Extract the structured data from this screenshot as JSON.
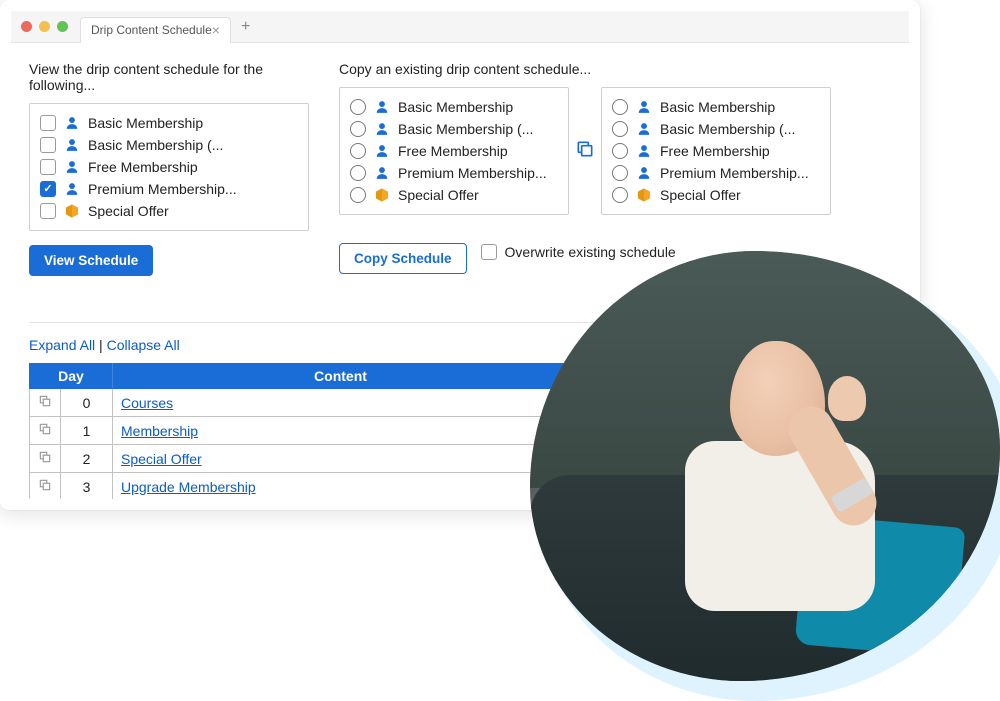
{
  "tab_title": "Drip Content Schedule",
  "view": {
    "heading": "View the drip content schedule for the following...",
    "items": [
      {
        "label": "Basic Membership",
        "type": "member",
        "checked": false
      },
      {
        "label": "Basic Membership (...",
        "type": "member",
        "checked": false
      },
      {
        "label": "Free Membership",
        "type": "member",
        "checked": false
      },
      {
        "label": "Premium Membership...",
        "type": "member",
        "checked": true
      },
      {
        "label": "Special Offer",
        "type": "package",
        "checked": false
      }
    ],
    "button": "View Schedule"
  },
  "copy": {
    "heading": "Copy an existing drip content schedule...",
    "items": [
      {
        "label": "Basic Membership",
        "type": "member"
      },
      {
        "label": "Basic Membership (...",
        "type": "member"
      },
      {
        "label": "Free Membership",
        "type": "member"
      },
      {
        "label": "Premium Membership...",
        "type": "member"
      },
      {
        "label": "Special Offer",
        "type": "package"
      }
    ],
    "items2": [
      {
        "label": "Basic Membership",
        "type": "member"
      },
      {
        "label": "Basic Membership (...",
        "type": "member"
      },
      {
        "label": "Free Membership",
        "type": "member"
      },
      {
        "label": "Premium Membership...",
        "type": "member"
      },
      {
        "label": "Special Offer",
        "type": "package"
      }
    ],
    "button": "Copy Schedule",
    "overwrite_label": "Overwrite existing schedule"
  },
  "links": {
    "expand": "Expand All",
    "sep": " | ",
    "collapse": "Collapse All"
  },
  "table": {
    "headers": {
      "day": "Day",
      "content": "Content"
    },
    "rows": [
      {
        "day": "0",
        "content": "Courses"
      },
      {
        "day": "1",
        "content": "Membership"
      },
      {
        "day": "2",
        "content": "Special Offer"
      },
      {
        "day": "3",
        "content": "Upgrade Membership"
      }
    ]
  }
}
